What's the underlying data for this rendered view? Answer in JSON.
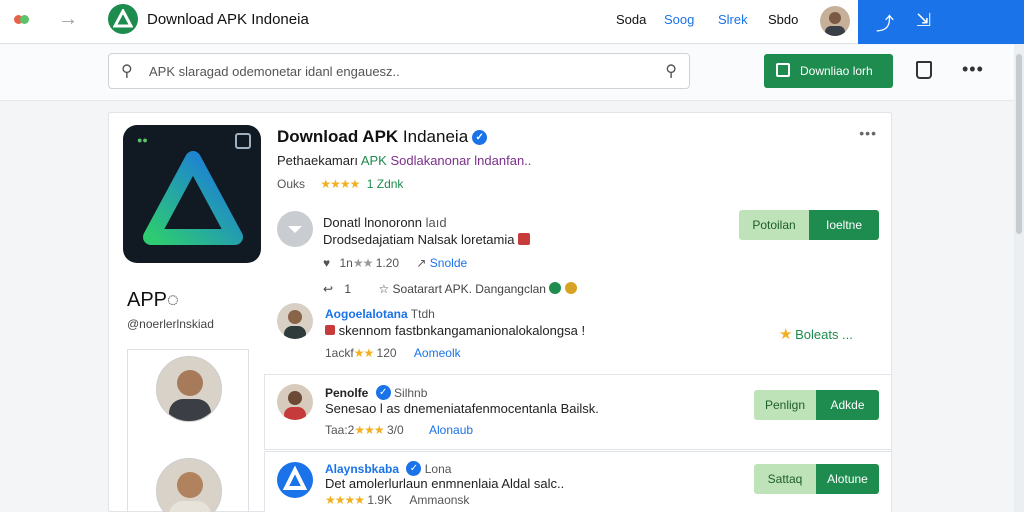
{
  "topbar": {
    "brand": "Download APK  Indoneia",
    "nav": [
      "Soda",
      "Soog",
      "Slrek",
      "Sbdo"
    ],
    "nav_colors": [
      "#111111",
      "#1a73e8",
      "#1a73e8",
      "#111111"
    ]
  },
  "search": {
    "placeholder": "APK slaragad odemonetar idanl engauesz.."
  },
  "download_button": {
    "label": "Downliao lorh"
  },
  "app": {
    "title_bold": "Download APK",
    "title_rest": " Indaneia",
    "subtitle_a": "Pethaekamarı ",
    "subtitle_green": "APK ",
    "subtitle_purple": "Sodlakanonar lndanfan..",
    "rating_label": "Ouks",
    "rating_stars": "★★★★",
    "rating_value": "1 Zdnk",
    "name": "APP◌",
    "handle": "@noerlerlnskiad"
  },
  "review1": {
    "name": "Donatl lnonoronn",
    "name_suffix": " laıd",
    "text": "Drodsedajatiam Nalsak loretamia",
    "likes": "1n",
    "stars": "★★",
    "score": "1.20",
    "action": "Snolde",
    "reply_count": "1",
    "reply_text": "Soatarart APK. Dangangclan",
    "btn_light": "Potoilan",
    "btn_dark": "Ioeltne"
  },
  "review2": {
    "name": "Aogoelalotana",
    "name_suffix": " Ttdh",
    "text": "skennom fastbnkangamanionalokalongsa !",
    "meta": "1ackf",
    "stars": "★★",
    "score": "120",
    "action": "Aomeolk",
    "badge": "Boleats ..."
  },
  "review3": {
    "name": "Penolfe",
    "name_suffix": " Silhnb",
    "text": "Senesao l as dnemeniatafenmocentanla Bailsk.",
    "meta": "Taa:2",
    "stars": "★★★",
    "score": "3/0",
    "action": "Alonaub",
    "btn_light": "Penlign",
    "btn_dark": "Adkde"
  },
  "review4": {
    "name": "Alaynsbkaba",
    "name_suffix": " Lona",
    "text": "Det amolerlurlaun enmnenlaia Aldal salc..",
    "stars": "★★★★",
    "score": "1.9K",
    "action": "Ammaonsk",
    "btn_light": "Sattaq",
    "btn_dark": "Alotune"
  },
  "colors": {
    "accent_green": "#1e8c4e",
    "light_green": "#bfe3b9",
    "brand_blue": "#1a73e8",
    "star_gold": "#f2b01e"
  }
}
